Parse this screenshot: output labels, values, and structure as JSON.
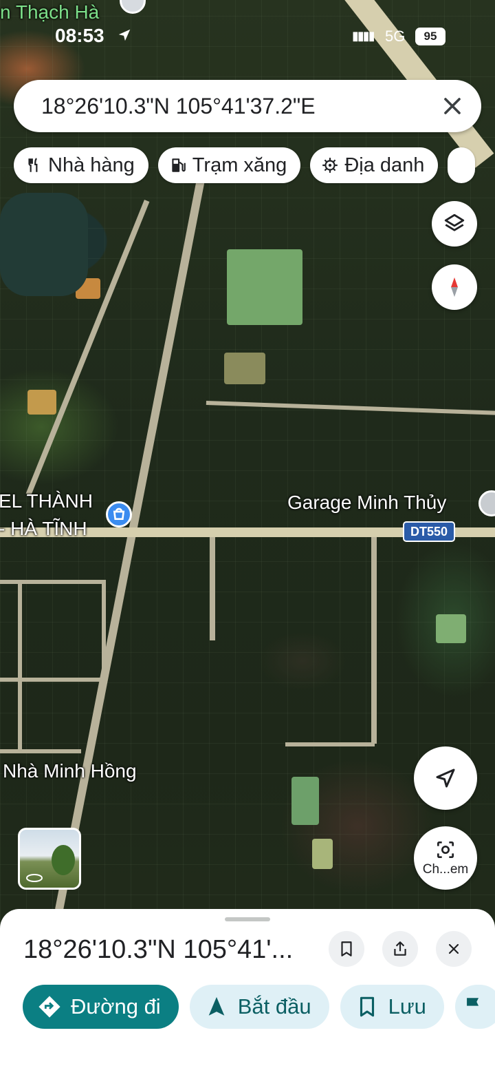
{
  "status_bar": {
    "time": "08:53",
    "network": "5G",
    "battery": "95",
    "signal_glyph": "▮▮▮▮"
  },
  "map": {
    "top_place_label": "n Thạch Hà",
    "label_left_1": "EL THÀNH",
    "label_left_2": "- HÀ TĨNH",
    "garage_label": "Garage Minh Thủy",
    "road_badge": "DT550",
    "house_label": "Nhà Minh Hồng"
  },
  "search": {
    "query": "18°26'10.3\"N 105°41'37.2\"E"
  },
  "chips": [
    {
      "label": "Nhà hàng",
      "icon": "restaurant-icon"
    },
    {
      "label": "Trạm xăng",
      "icon": "gas-station-icon"
    },
    {
      "label": "Địa danh",
      "icon": "landmark-icon"
    }
  ],
  "fab": {
    "camera_caption": "Ch...em"
  },
  "sheet": {
    "title": "18°26'10.3\"N 105°41'...",
    "actions": [
      {
        "label": "Đường đi",
        "icon": "directions-icon"
      },
      {
        "label": "Bắt đầu",
        "icon": "navigation-arrow-icon"
      },
      {
        "label": "Lưu",
        "icon": "bookmark-icon"
      }
    ]
  },
  "colors": {
    "primary_teal": "#0b7f83",
    "secondary_chip": "#dff0f6",
    "road_badge_blue": "#2a5ba8"
  }
}
